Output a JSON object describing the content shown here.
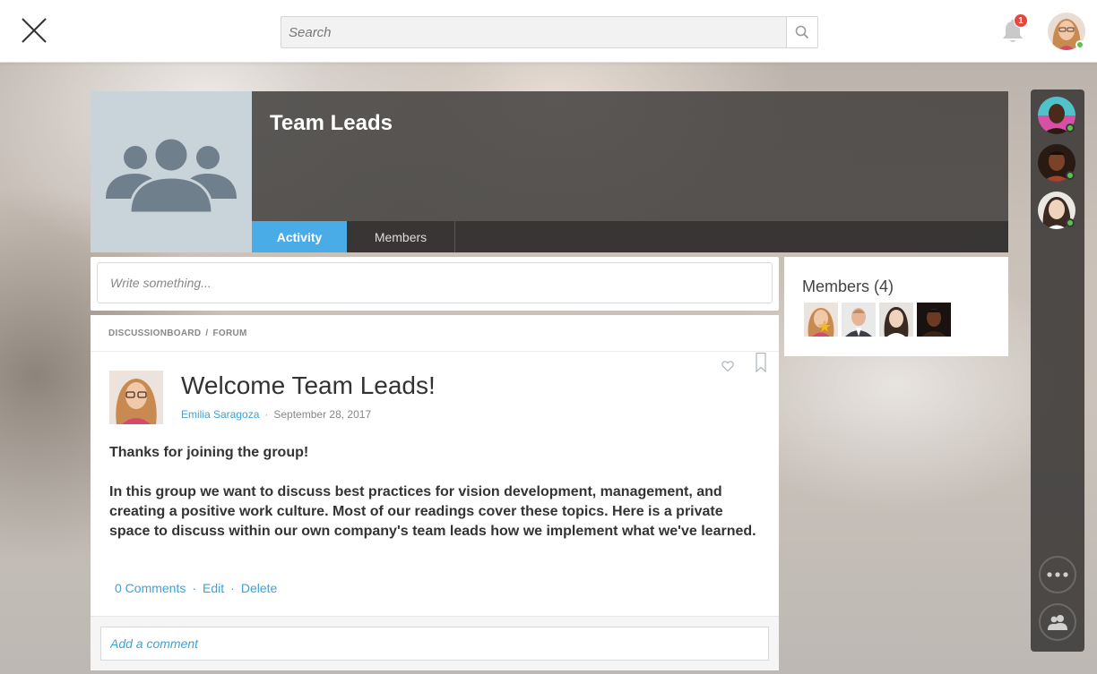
{
  "header": {
    "search_placeholder": "Search",
    "notification_count": "1"
  },
  "group": {
    "title": "Team Leads",
    "tabs": [
      {
        "label": "Activity",
        "active": true
      },
      {
        "label": "Members",
        "active": false
      }
    ]
  },
  "composer": {
    "placeholder": "Write something..."
  },
  "post": {
    "breadcrumb": [
      "DISCUSSIONBOARD",
      "/",
      "FORUM"
    ],
    "title": "Welcome Team Leads!",
    "author": "Emilia Saragoza",
    "date": "September 28, 2017",
    "body": [
      "Thanks for joining the group!",
      "In this group we want to discuss best practices for vision development, management, and creating a positive work culture. Most of our readings cover these topics. Here is a private space to discuss within our own company's team leads how we implement what we've learned."
    ],
    "actions": [
      "0 Comments",
      "Edit",
      "Delete"
    ],
    "separator": "·",
    "comment_placeholder": "Add a comment"
  },
  "members_panel": {
    "title": "Members (4)"
  },
  "colors": {
    "accent": "#4aace6",
    "link": "#3aa3d9",
    "online": "#5bc24d",
    "badge": "#e2483d"
  },
  "icons": [
    "close-icon",
    "search-icon",
    "bell-icon",
    "heart-icon",
    "bookmark-icon",
    "more-icon",
    "group-icon",
    "star-icon"
  ]
}
